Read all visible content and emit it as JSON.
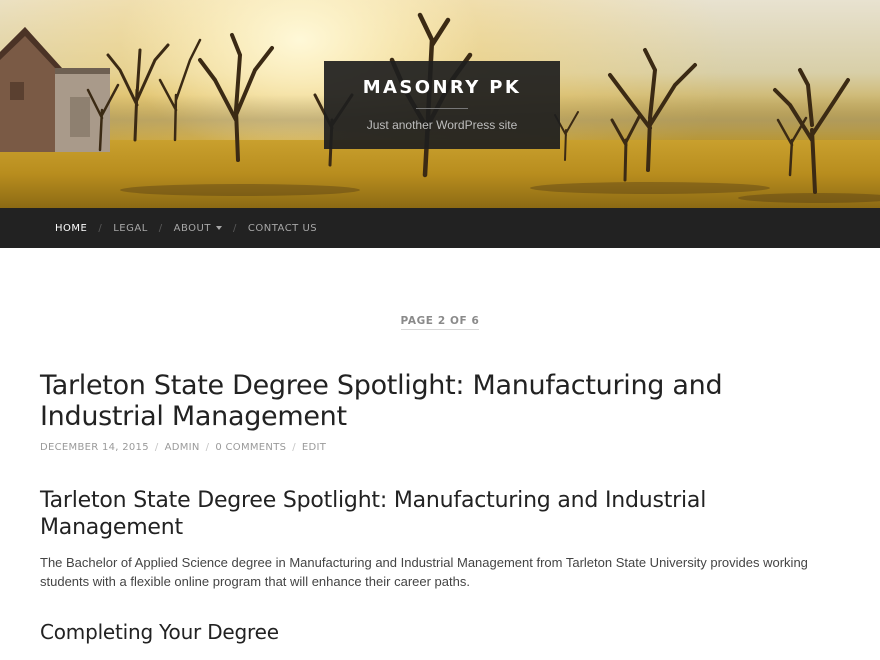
{
  "header": {
    "site_title": "MASONRY PK",
    "tagline": "Just another WordPress site"
  },
  "nav": {
    "items": [
      {
        "label": "HOME",
        "active": true
      },
      {
        "label": "LEGAL",
        "active": false
      },
      {
        "label": "ABOUT",
        "active": false,
        "has_dropdown": true
      },
      {
        "label": "CONTACT US",
        "active": false
      }
    ],
    "separator": "/"
  },
  "pagination": {
    "label": "PAGE 2 OF 6"
  },
  "post": {
    "title": "Tarleton State Degree Spotlight: Manufacturing and Industrial Management",
    "meta": {
      "date": "DECEMBER 14, 2015",
      "author": "ADMIN",
      "comments": "0 COMMENTS",
      "edit": "EDIT"
    },
    "content": {
      "heading": "Tarleton State Degree Spotlight: Manufacturing and Industrial Management",
      "paragraph": "The Bachelor of Applied Science degree in Manufacturing and Industrial Management from Tarleton State University provides working students with a flexible online program that will enhance their career paths.",
      "subheading": "Completing Your Degree"
    }
  },
  "colors": {
    "navbar_bg": "#222222",
    "branding_bg": "#1e1e1e",
    "nav_active": "#ffffff",
    "nav_inactive": "#a7a7a7",
    "meta_text": "#9a9a9a"
  }
}
